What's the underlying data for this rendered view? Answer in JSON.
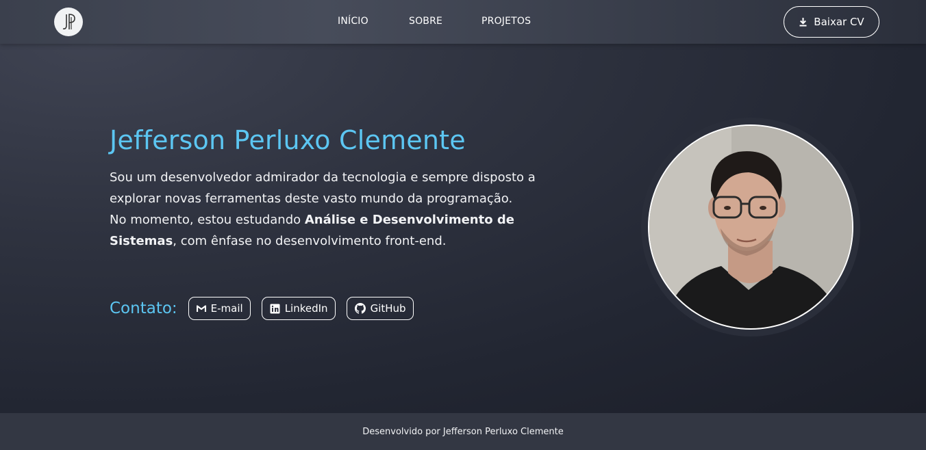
{
  "header": {
    "logo_alt": "JP",
    "nav": [
      {
        "label": "INÍCIO"
      },
      {
        "label": "SOBRE"
      },
      {
        "label": "PROJETOS"
      }
    ],
    "cv_button": {
      "label": "Baixar CV",
      "icon": "download-icon"
    }
  },
  "hero": {
    "name": "Jefferson Perluxo Clemente",
    "bio_line1": "Sou um desenvolvedor admirador da tecnologia e sempre disposto a explorar novas ferramentas deste vasto mundo da programação.",
    "bio_line2_prefix": "No momento, estou estudando ",
    "bio_line2_bold": "Análise e Desenvolvimento de Sistemas",
    "bio_line2_suffix": ", com ênfase no desenvolvimento front-end.",
    "contact": {
      "label": "Contato:",
      "links": [
        {
          "label": "E-mail",
          "icon": "gmail-icon"
        },
        {
          "label": "LinkedIn",
          "icon": "linkedin-icon"
        },
        {
          "label": "GitHub",
          "icon": "github-icon"
        }
      ]
    },
    "avatar_alt": "Foto de perfil"
  },
  "footer": {
    "text": "Desenvolvido por Jefferson Perluxo Clemente"
  },
  "colors": {
    "accent": "#5cc6f2",
    "background": "#232733",
    "header": "#454a58",
    "footer": "#333743"
  }
}
